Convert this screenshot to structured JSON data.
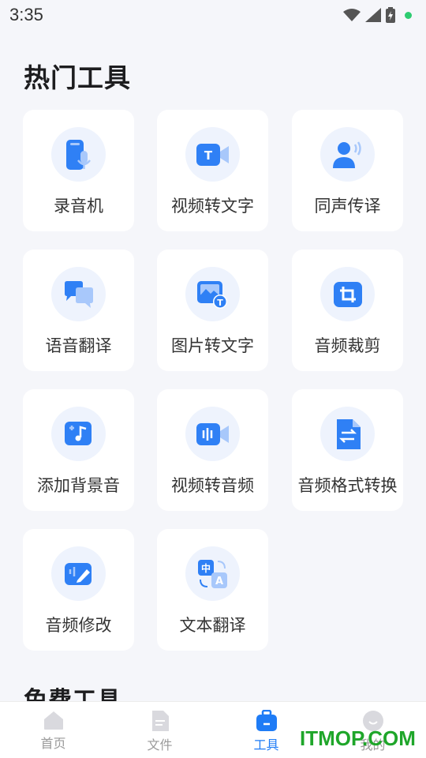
{
  "status_bar": {
    "time": "3:35"
  },
  "sections": {
    "hot_tools_title": "热门工具",
    "free_tools_title": "免费工具"
  },
  "tools": [
    {
      "label": "录音机",
      "icon": "recorder-icon"
    },
    {
      "label": "视频转文字",
      "icon": "video-to-text-icon"
    },
    {
      "label": "同声传译",
      "icon": "simultaneous-interpretation-icon"
    },
    {
      "label": "语音翻译",
      "icon": "voice-translate-icon"
    },
    {
      "label": "图片转文字",
      "icon": "image-to-text-icon"
    },
    {
      "label": "音频裁剪",
      "icon": "audio-crop-icon"
    },
    {
      "label": "添加背景音",
      "icon": "add-background-music-icon"
    },
    {
      "label": "视频转音频",
      "icon": "video-to-audio-icon"
    },
    {
      "label": "音频格式转换",
      "icon": "audio-format-convert-icon"
    },
    {
      "label": "音频修改",
      "icon": "audio-edit-icon"
    },
    {
      "label": "文本翻译",
      "icon": "text-translate-icon"
    }
  ],
  "bottom_nav": {
    "items": [
      {
        "label": "首页",
        "icon": "home-icon",
        "active": false
      },
      {
        "label": "文件",
        "icon": "file-icon",
        "active": false
      },
      {
        "label": "工具",
        "icon": "toolbox-icon",
        "active": true
      },
      {
        "label": "我的",
        "icon": "profile-icon",
        "active": false
      }
    ]
  },
  "watermark": "ITMOP.COM",
  "colors": {
    "accent": "#1f7cf6",
    "icon_blue": "#2f80f5",
    "icon_light": "#a8c8fb",
    "tile_bg": "#ffffff",
    "page_bg": "#f5f6fa"
  }
}
